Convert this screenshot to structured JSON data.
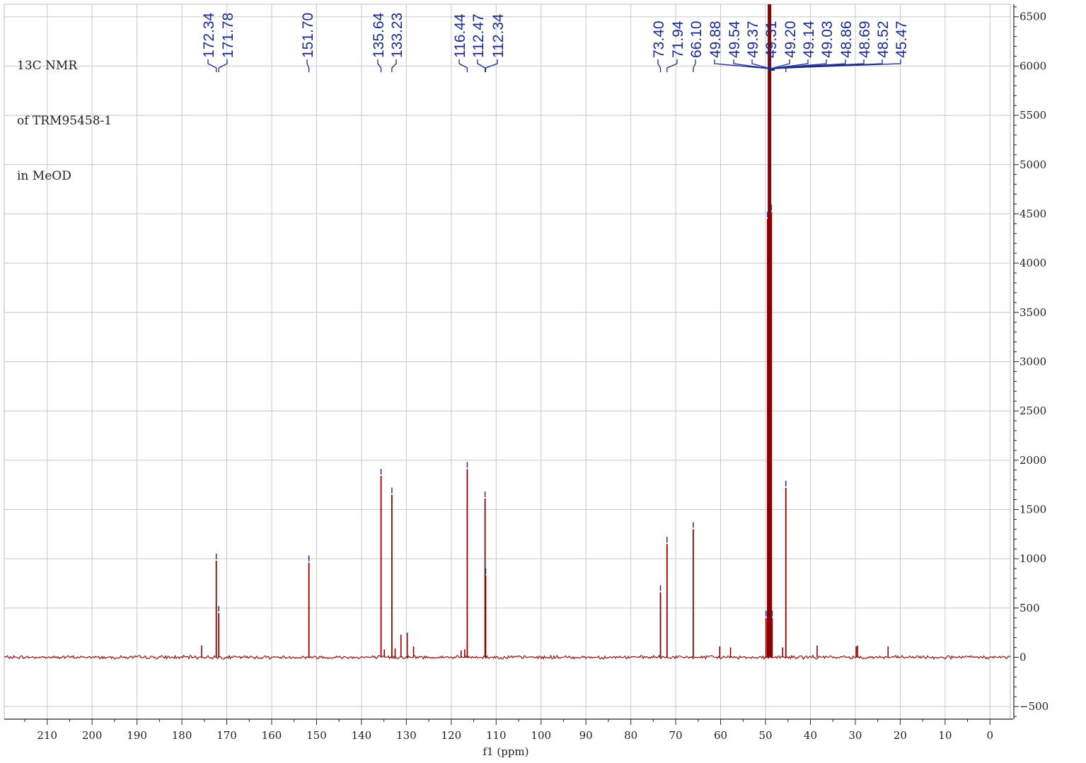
{
  "chart_data": {
    "type": "line",
    "sample_label": [
      "13C NMR",
      "of TRM95458-1",
      "in MeOD"
    ],
    "xlabel": "f1 (ppm)",
    "ylabel": "",
    "xlim": [
      216.5,
      -4.3
    ],
    "ylim": [
      -630,
      6650
    ],
    "x_ticks": [
      210,
      200,
      190,
      180,
      170,
      160,
      150,
      140,
      130,
      120,
      110,
      100,
      90,
      80,
      70,
      60,
      50,
      40,
      30,
      20,
      10,
      0
    ],
    "y_ticks": [
      -500,
      0,
      500,
      1000,
      1500,
      2000,
      2500,
      3000,
      3500,
      4000,
      4500,
      5000,
      5500,
      6000,
      6500
    ],
    "grid": true,
    "colors": {
      "spectrum": "#8b0000",
      "peak_labels": "#1c2c8c",
      "grid": "#c8c8c8",
      "axis": "#222222"
    },
    "peak_labels": [
      "172.34",
      "171.78",
      "151.70",
      "135.64",
      "133.23",
      "116.44",
      "112.47",
      "112.34",
      "73.40",
      "71.94",
      "66.10",
      "49.88",
      "49.54",
      "49.37",
      "49.31",
      "49.20",
      "49.14",
      "49.03",
      "48.86",
      "48.69",
      "48.52",
      "45.47"
    ],
    "peaks": [
      {
        "x": 172.34,
        "y": 980
      },
      {
        "x": 171.78,
        "y": 450
      },
      {
        "x": 151.7,
        "y": 960
      },
      {
        "x": 135.64,
        "y": 1840
      },
      {
        "x": 133.23,
        "y": 1650
      },
      {
        "x": 116.44,
        "y": 1910
      },
      {
        "x": 112.47,
        "y": 1610
      },
      {
        "x": 112.34,
        "y": 830
      },
      {
        "x": 73.4,
        "y": 660
      },
      {
        "x": 71.94,
        "y": 1150
      },
      {
        "x": 66.1,
        "y": 1300
      },
      {
        "x": 49.88,
        "y": 400
      },
      {
        "x": 49.54,
        "y": 4450
      },
      {
        "x": 49.37,
        "y": 6700
      },
      {
        "x": 49.31,
        "y": 6700
      },
      {
        "x": 49.2,
        "y": 6700
      },
      {
        "x": 49.14,
        "y": 6700
      },
      {
        "x": 49.03,
        "y": 6700
      },
      {
        "x": 48.86,
        "y": 6700
      },
      {
        "x": 48.69,
        "y": 4520
      },
      {
        "x": 48.52,
        "y": 400
      },
      {
        "x": 45.47,
        "y": 1720
      }
    ],
    "minor_peaks": [
      {
        "x": 175.6,
        "y": 120
      },
      {
        "x": 134.9,
        "y": 80
      },
      {
        "x": 132.5,
        "y": 90
      },
      {
        "x": 131.2,
        "y": 230
      },
      {
        "x": 129.8,
        "y": 250
      },
      {
        "x": 128.4,
        "y": 110
      },
      {
        "x": 117.8,
        "y": 70
      },
      {
        "x": 117.0,
        "y": 80
      },
      {
        "x": 60.2,
        "y": 110
      },
      {
        "x": 57.8,
        "y": 100
      },
      {
        "x": 46.2,
        "y": 100
      },
      {
        "x": 38.5,
        "y": 120
      },
      {
        "x": 29.8,
        "y": 110
      },
      {
        "x": 29.5,
        "y": 120
      },
      {
        "x": 22.7,
        "y": 110
      }
    ]
  }
}
